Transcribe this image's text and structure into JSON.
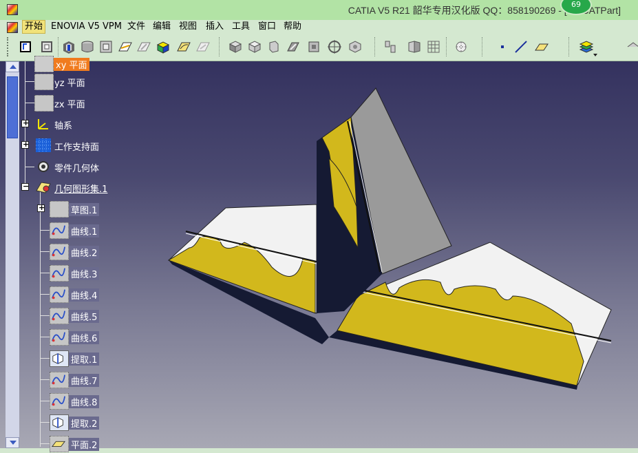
{
  "window": {
    "title": "CATIA V5 R21 韶华专用汉化版 QQ：858190269 - [tail.CATPart]",
    "badge_count": "69"
  },
  "menu": {
    "items": [
      {
        "label": "开始",
        "active": true
      },
      {
        "label": "ENOVIA V5 VPM",
        "active": false
      },
      {
        "label": "文件",
        "active": false
      },
      {
        "label": "编辑",
        "active": false
      },
      {
        "label": "视图",
        "active": false
      },
      {
        "label": "插入",
        "active": false
      },
      {
        "label": "工具",
        "active": false
      },
      {
        "label": "窗口",
        "active": false
      },
      {
        "label": "帮助",
        "active": false
      }
    ]
  },
  "toolbar": {
    "buttons": [
      "sketch-icon",
      "positioned-sketch-icon",
      "pad-icon",
      "pocket-icon",
      "shaft-icon",
      "surface-icon",
      "fill-icon",
      "boolean-icon",
      "multi-section-icon",
      "blend-icon",
      "view-iso-icon",
      "view-front-icon",
      "view-right-icon",
      "view-top-icon",
      "view-rear-icon",
      "fly-icon",
      "mesh-icon",
      "analysis-icon",
      "point-icon",
      "line-icon",
      "plane-icon",
      "apply-material-icon",
      "more-icon"
    ]
  },
  "tree": {
    "items": [
      {
        "label": "xy 平面",
        "kind": "plane",
        "highlight": true
      },
      {
        "label": "yz 平面",
        "kind": "plane"
      },
      {
        "label": "zx 平面",
        "kind": "plane"
      },
      {
        "label": "轴系",
        "kind": "axis",
        "expander": "+"
      },
      {
        "label": "工作支持面",
        "kind": "grid",
        "expander": "+"
      },
      {
        "label": "零件几何体",
        "kind": "body"
      },
      {
        "label": "几何图形集.1",
        "kind": "geoset",
        "expander": "−",
        "selected": true
      },
      {
        "label": "草图.1",
        "kind": "sketch",
        "expander": "+"
      },
      {
        "label": "曲线.1",
        "kind": "curve"
      },
      {
        "label": "曲线.2",
        "kind": "curve"
      },
      {
        "label": "曲线.3",
        "kind": "curve"
      },
      {
        "label": "曲线.4",
        "kind": "curve"
      },
      {
        "label": "曲线.5",
        "kind": "curve"
      },
      {
        "label": "曲线.6",
        "kind": "curve"
      },
      {
        "label": "提取.1",
        "kind": "extract"
      },
      {
        "label": "曲线.7",
        "kind": "curve"
      },
      {
        "label": "曲线.8",
        "kind": "curve"
      },
      {
        "label": "提取.2",
        "kind": "extract"
      },
      {
        "label": "平面.2",
        "kind": "plane"
      }
    ]
  },
  "colors": {
    "viewport_top": "#34325f",
    "viewport_bottom": "#a8a8b4",
    "wing_yellow": "#d2b81c",
    "wing_white": "#f2f2f2",
    "fin_gray": "#9a9a9a",
    "wing_dark": "#151a33"
  }
}
